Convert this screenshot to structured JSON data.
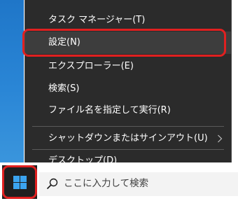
{
  "desktop": {
    "accent": "#2a86d6"
  },
  "context_menu": {
    "background": "#2b2b2b",
    "items": [
      {
        "label": "タスク マネージャー(T)"
      },
      {
        "label": "設定(N)",
        "state": "hover"
      },
      {
        "label": "エクスプローラー(E)"
      },
      {
        "label": "検索(S)"
      },
      {
        "label": "ファイル名を指定して実行(R)"
      },
      {
        "label": "シャットダウンまたはサインアウト(U)",
        "has_submenu": true
      },
      {
        "label": "デスクトップ(D)"
      }
    ]
  },
  "taskbar": {
    "start_icon": "windows-logo-icon",
    "search": {
      "icon": "search-icon",
      "placeholder": "ここに入力して検索"
    }
  },
  "highlight_color": "#e02020"
}
